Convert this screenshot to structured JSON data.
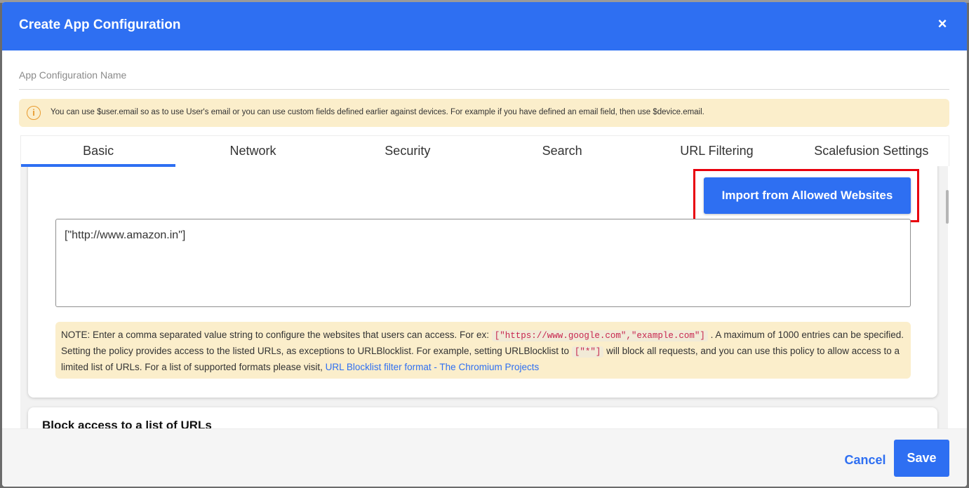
{
  "modal": {
    "title": "Create App Configuration",
    "close_icon": "close-icon",
    "close_label": "×"
  },
  "config_name": {
    "placeholder": "App Configuration Name",
    "value": ""
  },
  "info_banner": {
    "icon": "info-icon",
    "icon_glyph": "i",
    "text": "You can use $user.email so as to use User's email or you can use custom fields defined earlier against devices. For example if you have defined an email field, then use $device.email."
  },
  "tabs": [
    {
      "label": "Basic",
      "active": true
    },
    {
      "label": "Network",
      "active": false
    },
    {
      "label": "Security",
      "active": false
    },
    {
      "label": "Search",
      "active": false
    },
    {
      "label": "URL Filtering",
      "active": false
    },
    {
      "label": "Scalefusion Settings",
      "active": false
    }
  ],
  "allow_section": {
    "import_button_label": "Import from Allowed Websites",
    "textarea_value": "[\"http://www.amazon.in\"]",
    "note": {
      "prefix": "NOTE: Enter a comma separated value string to configure the websites that users can access. For ex: ",
      "example_code": "[\"https://www.google.com\",\"example.com\"]",
      "mid_1": " . A maximum of 1000 entries can be specified. Setting the policy provides access to the listed URLs, as exceptions to URLBlocklist. For example, setting URLBlocklist to ",
      "block_all_code": "[\"*\"]",
      "mid_2": " will block all requests, and you can use this policy to allow access to a limited list of URLs. For a list of supported formats please visit, ",
      "link_text": "URL Blocklist filter format - The Chromium Projects"
    }
  },
  "block_section": {
    "title": "Block access to a list of URLs"
  },
  "footer": {
    "cancel_label": "Cancel",
    "save_label": "Save"
  },
  "colors": {
    "primary": "#2e6ff2",
    "highlight_border": "#e8000d",
    "note_background": "#fbeecb",
    "warning_icon": "#e89a2e"
  }
}
